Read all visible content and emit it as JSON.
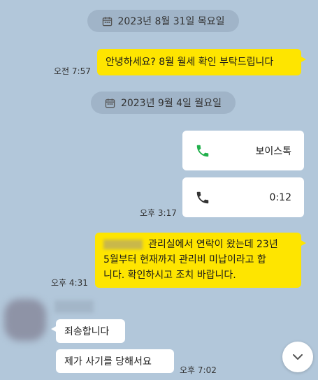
{
  "dates": {
    "first": "2023년 8월 31일 목요일",
    "second": "2023년 9월 4일 월요일"
  },
  "messages": {
    "m1": {
      "text": "안녕하세요? 8월 월세 확인 부탁드립니다",
      "time": "오전 7:57"
    },
    "call1": {
      "label": "보이스톡"
    },
    "call2": {
      "label": "0:12",
      "time": "오후 3:17"
    },
    "m3": {
      "line1": "관리실에서 연락이 왔는데 23년",
      "line2": "5월부터 현재까지 관리비 미납이라고 합",
      "line3": "니다. 확인하시고 조치 바랍니다.",
      "time": "오후 4:31"
    },
    "r1": {
      "text": "죄송합니다"
    },
    "r2": {
      "text": "제가 사기를 당해서요",
      "time": "오후 7:02"
    }
  },
  "icons": {
    "calendar": "calendar-icon",
    "phone_active": "phone-icon",
    "phone_ended": "phone-icon",
    "scroll": "chevron-down-icon"
  },
  "colors": {
    "background": "#b2c7da",
    "my_bubble": "#fee500",
    "other_bubble": "#ffffff",
    "voice_call_green": "#21b04b"
  }
}
